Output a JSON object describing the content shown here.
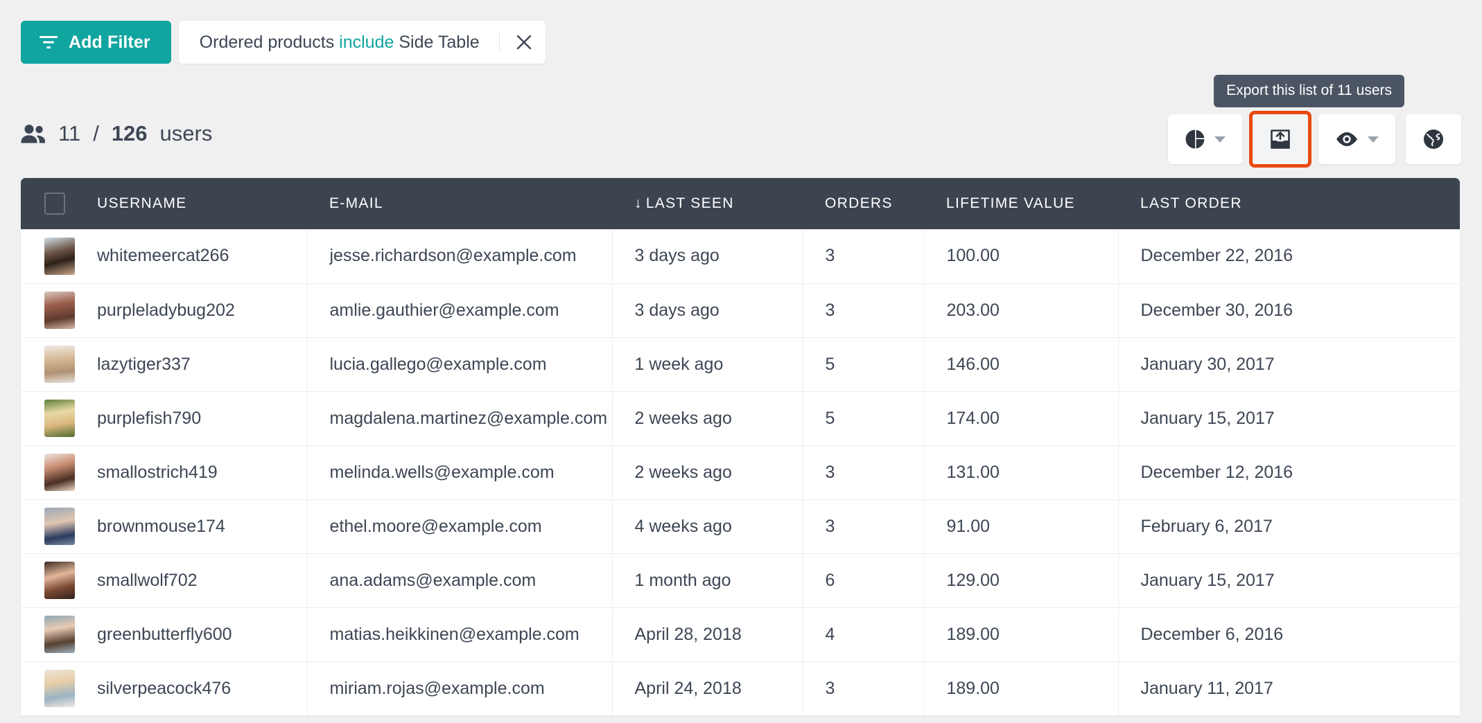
{
  "colors": {
    "accent": "#11a5a0",
    "header_bg": "#3c4450",
    "highlight": "#e8490f",
    "tooltip_bg": "#4b5563",
    "page_bg": "#f0f0f1",
    "text": "#3d4654"
  },
  "filter_bar": {
    "add_filter_label": "Add Filter",
    "filter_icon": "filter-icon",
    "chip": {
      "field": "Ordered products",
      "operator": "include",
      "value": "Side Table",
      "close_icon": "close-icon"
    }
  },
  "tooltip": {
    "text": "Export this list of 11 users"
  },
  "toolbar": {
    "buttons": [
      {
        "name": "chart-view-button",
        "icon": "pie-chart-icon",
        "has_caret": true,
        "highlighted": false
      },
      {
        "name": "export-button",
        "icon": "export-icon",
        "has_caret": false,
        "highlighted": true
      },
      {
        "name": "visible-columns-button",
        "icon": "eye-icon",
        "has_caret": true,
        "highlighted": false
      },
      {
        "name": "globe-button",
        "icon": "globe-icon",
        "has_caret": false,
        "highlighted": false
      }
    ]
  },
  "count": {
    "icon": "users-icon",
    "shown": "11",
    "separator": "/",
    "total": "126",
    "label": "users"
  },
  "table": {
    "select_all_checkbox": "select-all-checkbox",
    "sort_indicator": "↓",
    "sorted_column": "LAST SEEN",
    "columns": [
      "USERNAME",
      "E-MAIL",
      "LAST SEEN",
      "ORDERS",
      "LIFETIME VALUE",
      "LAST ORDER"
    ],
    "rows": [
      {
        "username": "whitemeercat266",
        "email": "jesse.richardson@example.com",
        "last_seen": "3 days ago",
        "orders": "3",
        "lifetime_value": "100.00",
        "last_order": "December 22, 2016"
      },
      {
        "username": "purpleladybug202",
        "email": "amlie.gauthier@example.com",
        "last_seen": "3 days ago",
        "orders": "3",
        "lifetime_value": "203.00",
        "last_order": "December 30, 2016"
      },
      {
        "username": "lazytiger337",
        "email": "lucia.gallego@example.com",
        "last_seen": "1 week ago",
        "orders": "5",
        "lifetime_value": "146.00",
        "last_order": "January 30, 2017"
      },
      {
        "username": "purplefish790",
        "email": "magdalena.martinez@example.com",
        "last_seen": "2 weeks ago",
        "orders": "5",
        "lifetime_value": "174.00",
        "last_order": "January 15, 2017"
      },
      {
        "username": "smallostrich419",
        "email": "melinda.wells@example.com",
        "last_seen": "2 weeks ago",
        "orders": "3",
        "lifetime_value": "131.00",
        "last_order": "December 12, 2016"
      },
      {
        "username": "brownmouse174",
        "email": "ethel.moore@example.com",
        "last_seen": "4 weeks ago",
        "orders": "3",
        "lifetime_value": "91.00",
        "last_order": "February 6, 2017"
      },
      {
        "username": "smallwolf702",
        "email": "ana.adams@example.com",
        "last_seen": "1 month ago",
        "orders": "6",
        "lifetime_value": "129.00",
        "last_order": "January 15, 2017"
      },
      {
        "username": "greenbutterfly600",
        "email": "matias.heikkinen@example.com",
        "last_seen": "April 28, 2018",
        "orders": "4",
        "lifetime_value": "189.00",
        "last_order": "December 6, 2016"
      },
      {
        "username": "silverpeacock476",
        "email": "miriam.rojas@example.com",
        "last_seen": "April 24, 2018",
        "orders": "3",
        "lifetime_value": "189.00",
        "last_order": "January 11, 2017"
      }
    ]
  }
}
